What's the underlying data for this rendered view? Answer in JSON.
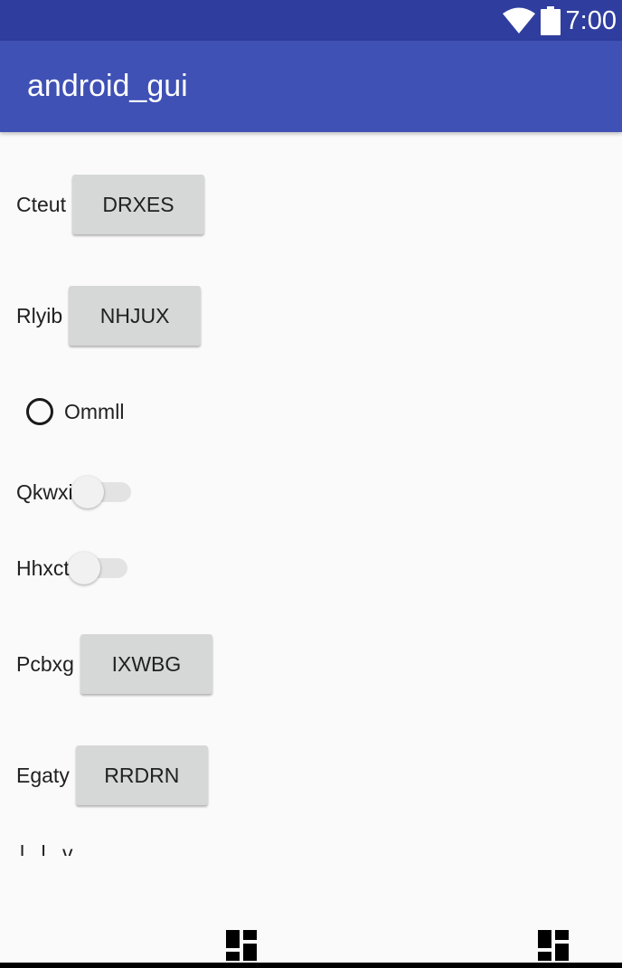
{
  "status_bar": {
    "time": "7:00",
    "icons": [
      "wifi-icon",
      "battery-icon"
    ]
  },
  "app_bar": {
    "title": "android_gui"
  },
  "rows": {
    "cteut": {
      "label": "Cteut",
      "button": "DRXES"
    },
    "rlyib": {
      "label": "Rlyib",
      "button": "NHJUX"
    },
    "ommll": {
      "label": "Ommll",
      "checked": false
    },
    "qkwxi": {
      "label": "Qkwxi",
      "on": false
    },
    "hhxct": {
      "label": "Hhxct",
      "on": false
    },
    "pcbxg": {
      "label": "Pcbxg",
      "button": "IXWBG"
    },
    "egaty": {
      "label": "Egaty",
      "button": "RRDRN"
    }
  },
  "partial_label": "l  l  v",
  "nav_bar": {
    "icons": [
      "dashboard-icon",
      "dashboard-icon"
    ]
  },
  "colors": {
    "status_bar": "#2f3e9e",
    "app_bar": "#3f51b5",
    "button": "#d6d7d7",
    "background": "#fafafa"
  }
}
